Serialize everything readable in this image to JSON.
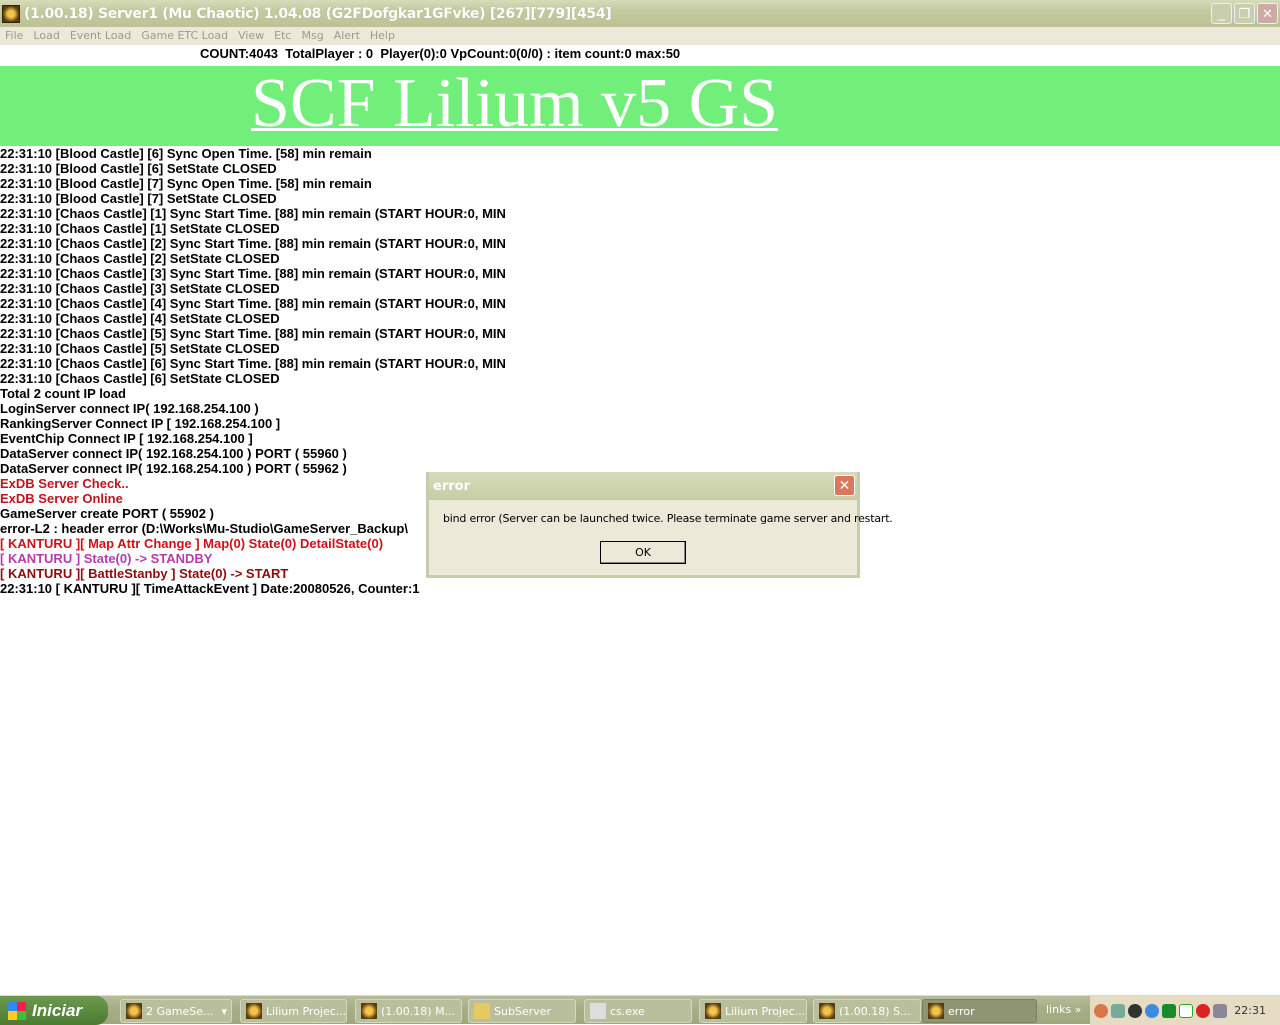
{
  "window": {
    "title": "(1.00.18) Server1 (Mu Chaotic) 1.04.08 (G2FDofgkar1GFvke) [267][779][454]"
  },
  "menu": [
    "File",
    "Load",
    "Event Load",
    "Game ETC Load",
    "View",
    "Etc",
    "Msg",
    "Alert",
    "Help"
  ],
  "status": "COUNT:4043  TotalPlayer : 0  Player(0):0 VpCount:0(0/0) : item count:0 max:50",
  "banner": "SCF Lilium v5 GS",
  "log": [
    {
      "t": "22:31:10 [Blood Castle] [6] Sync Open Time. [58] min remain",
      "c": "#000000"
    },
    {
      "t": "22:31:10 [Blood Castle] [6] SetState CLOSED",
      "c": "#000000"
    },
    {
      "t": "22:31:10 [Blood Castle] [7] Sync Open Time. [58] min remain",
      "c": "#000000"
    },
    {
      "t": "22:31:10 [Blood Castle] [7] SetState CLOSED",
      "c": "#000000"
    },
    {
      "t": "22:31:10 [Chaos Castle] [1] Sync Start Time. [88] min remain (START HOUR:0, MIN",
      "c": "#000000"
    },
    {
      "t": "22:31:10 [Chaos Castle] [1] SetState CLOSED",
      "c": "#000000"
    },
    {
      "t": "22:31:10 [Chaos Castle] [2] Sync Start Time. [88] min remain (START HOUR:0, MIN",
      "c": "#000000"
    },
    {
      "t": "22:31:10 [Chaos Castle] [2] SetState CLOSED",
      "c": "#000000"
    },
    {
      "t": "22:31:10 [Chaos Castle] [3] Sync Start Time. [88] min remain (START HOUR:0, MIN",
      "c": "#000000"
    },
    {
      "t": "22:31:10 [Chaos Castle] [3] SetState CLOSED",
      "c": "#000000"
    },
    {
      "t": "22:31:10 [Chaos Castle] [4] Sync Start Time. [88] min remain (START HOUR:0, MIN",
      "c": "#000000"
    },
    {
      "t": "22:31:10 [Chaos Castle] [4] SetState CLOSED",
      "c": "#000000"
    },
    {
      "t": "22:31:10 [Chaos Castle] [5] Sync Start Time. [88] min remain (START HOUR:0, MIN",
      "c": "#000000"
    },
    {
      "t": "22:31:10 [Chaos Castle] [5] SetState CLOSED",
      "c": "#000000"
    },
    {
      "t": "22:31:10 [Chaos Castle] [6] Sync Start Time. [88] min remain (START HOUR:0, MIN",
      "c": "#000000"
    },
    {
      "t": "22:31:10 [Chaos Castle] [6] SetState CLOSED",
      "c": "#000000"
    },
    {
      "t": "Total 2 count IP load",
      "c": "#000000"
    },
    {
      "t": "LoginServer connect IP( 192.168.254.100 )",
      "c": "#000000"
    },
    {
      "t": "RankingServer Connect IP [ 192.168.254.100 ]",
      "c": "#000000"
    },
    {
      "t": "EventChip Connect IP [ 192.168.254.100 ]",
      "c": "#000000"
    },
    {
      "t": "DataServer connect IP( 192.168.254.100 ) PORT ( 55960 )",
      "c": "#000000"
    },
    {
      "t": "DataServer connect IP( 192.168.254.100 ) PORT ( 55962 )",
      "c": "#000000"
    },
    {
      "t": "ExDB Server Check..",
      "c": "#c0141e"
    },
    {
      "t": "ExDB Server Online",
      "c": "#c0141e"
    },
    {
      "t": "GameServer create PORT ( 55902 )",
      "c": "#000000"
    },
    {
      "t": "error-L2 : header error (D:\\Works\\Mu-Studio\\GameServer_Backup\\",
      "c": "#000000"
    },
    {
      "t": "[ KANTURU ][ Map Attr Change ] Map(0) State(0) DetailState(0)",
      "c": "#d0101a"
    },
    {
      "t": "[ KANTURU ] State(0) -> STANDBY",
      "c": "#b23cb0"
    },
    {
      "t": "[ KANTURU ][ BattleStanby ] State(0) -> START",
      "c": "#8c0c10"
    },
    {
      "t": "22:31:10 [ KANTURU ][ TimeAttackEvent ] Date:20080526, Counter:1",
      "c": "#000000"
    }
  ],
  "dialog": {
    "title": "error",
    "message": "bind error (Server can be launched twice. Please terminate game server and restart.",
    "ok": "OK"
  },
  "taskbar": {
    "start": "Iniciar",
    "tasks": [
      "2 GameSe...",
      "Lilium Projec...",
      "(1.00.18) M...",
      "SubServer",
      "cs.exe",
      "Lilium Projec...",
      "(1.00.18) S...",
      "error"
    ],
    "links": "links »",
    "clock": "22:31"
  }
}
